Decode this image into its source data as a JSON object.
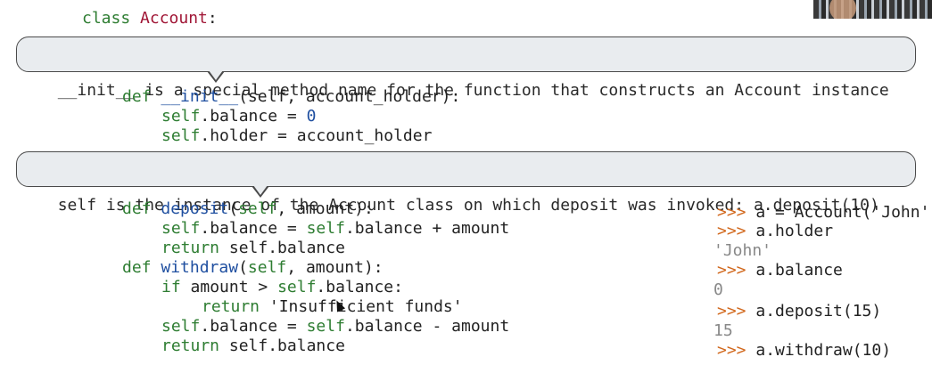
{
  "code": {
    "class_kw": "class",
    "class_name": "Account",
    "class_colon": ":",
    "def_kw": "def",
    "init_name": "__init__",
    "init_params": "(self, account_holder):",
    "self_kw": "self",
    "balance_attr": ".balance = ",
    "zero": "0",
    "holder_line": ".holder = account_holder",
    "deposit_name": "deposit",
    "deposit_params_pre": "(",
    "deposit_params_post": ", amount):",
    "deposit_body_1_a": ".balance = ",
    "deposit_body_1_b": ".balance + amount",
    "return_kw": "return",
    "return_balance": " self.balance",
    "withdraw_name": "withdraw",
    "withdraw_params_post": ", amount):",
    "if_kw": "if",
    "if_cond_a": " amount > ",
    "if_cond_b": ".balance:",
    "insufficient_str": " 'Insufficient funds'",
    "withdraw_body_a": ".balance = ",
    "withdraw_body_b": ".balance - amount"
  },
  "callouts": {
    "init": "__init__ is a special method name for the function that constructs an Account instance",
    "self": "self is the instance of the Account class on which deposit was invoked: a.deposit(10)"
  },
  "repl": {
    "prompt": ">>>",
    "cmd1": " a = Account('John'",
    "cmd2": " a.holder",
    "out2": "'John'",
    "cmd3": " a.balance",
    "out3": "0",
    "cmd4": " a.deposit(15)",
    "out4": "15",
    "cmd5": " a.withdraw(10)"
  },
  "colors": {
    "keyword": "#2e7d32",
    "function_name": "#1f4fa0",
    "class_name": "#a01535",
    "prompt": "#d2691e",
    "output": "#888888",
    "callout_bg": "#e9ecef"
  }
}
